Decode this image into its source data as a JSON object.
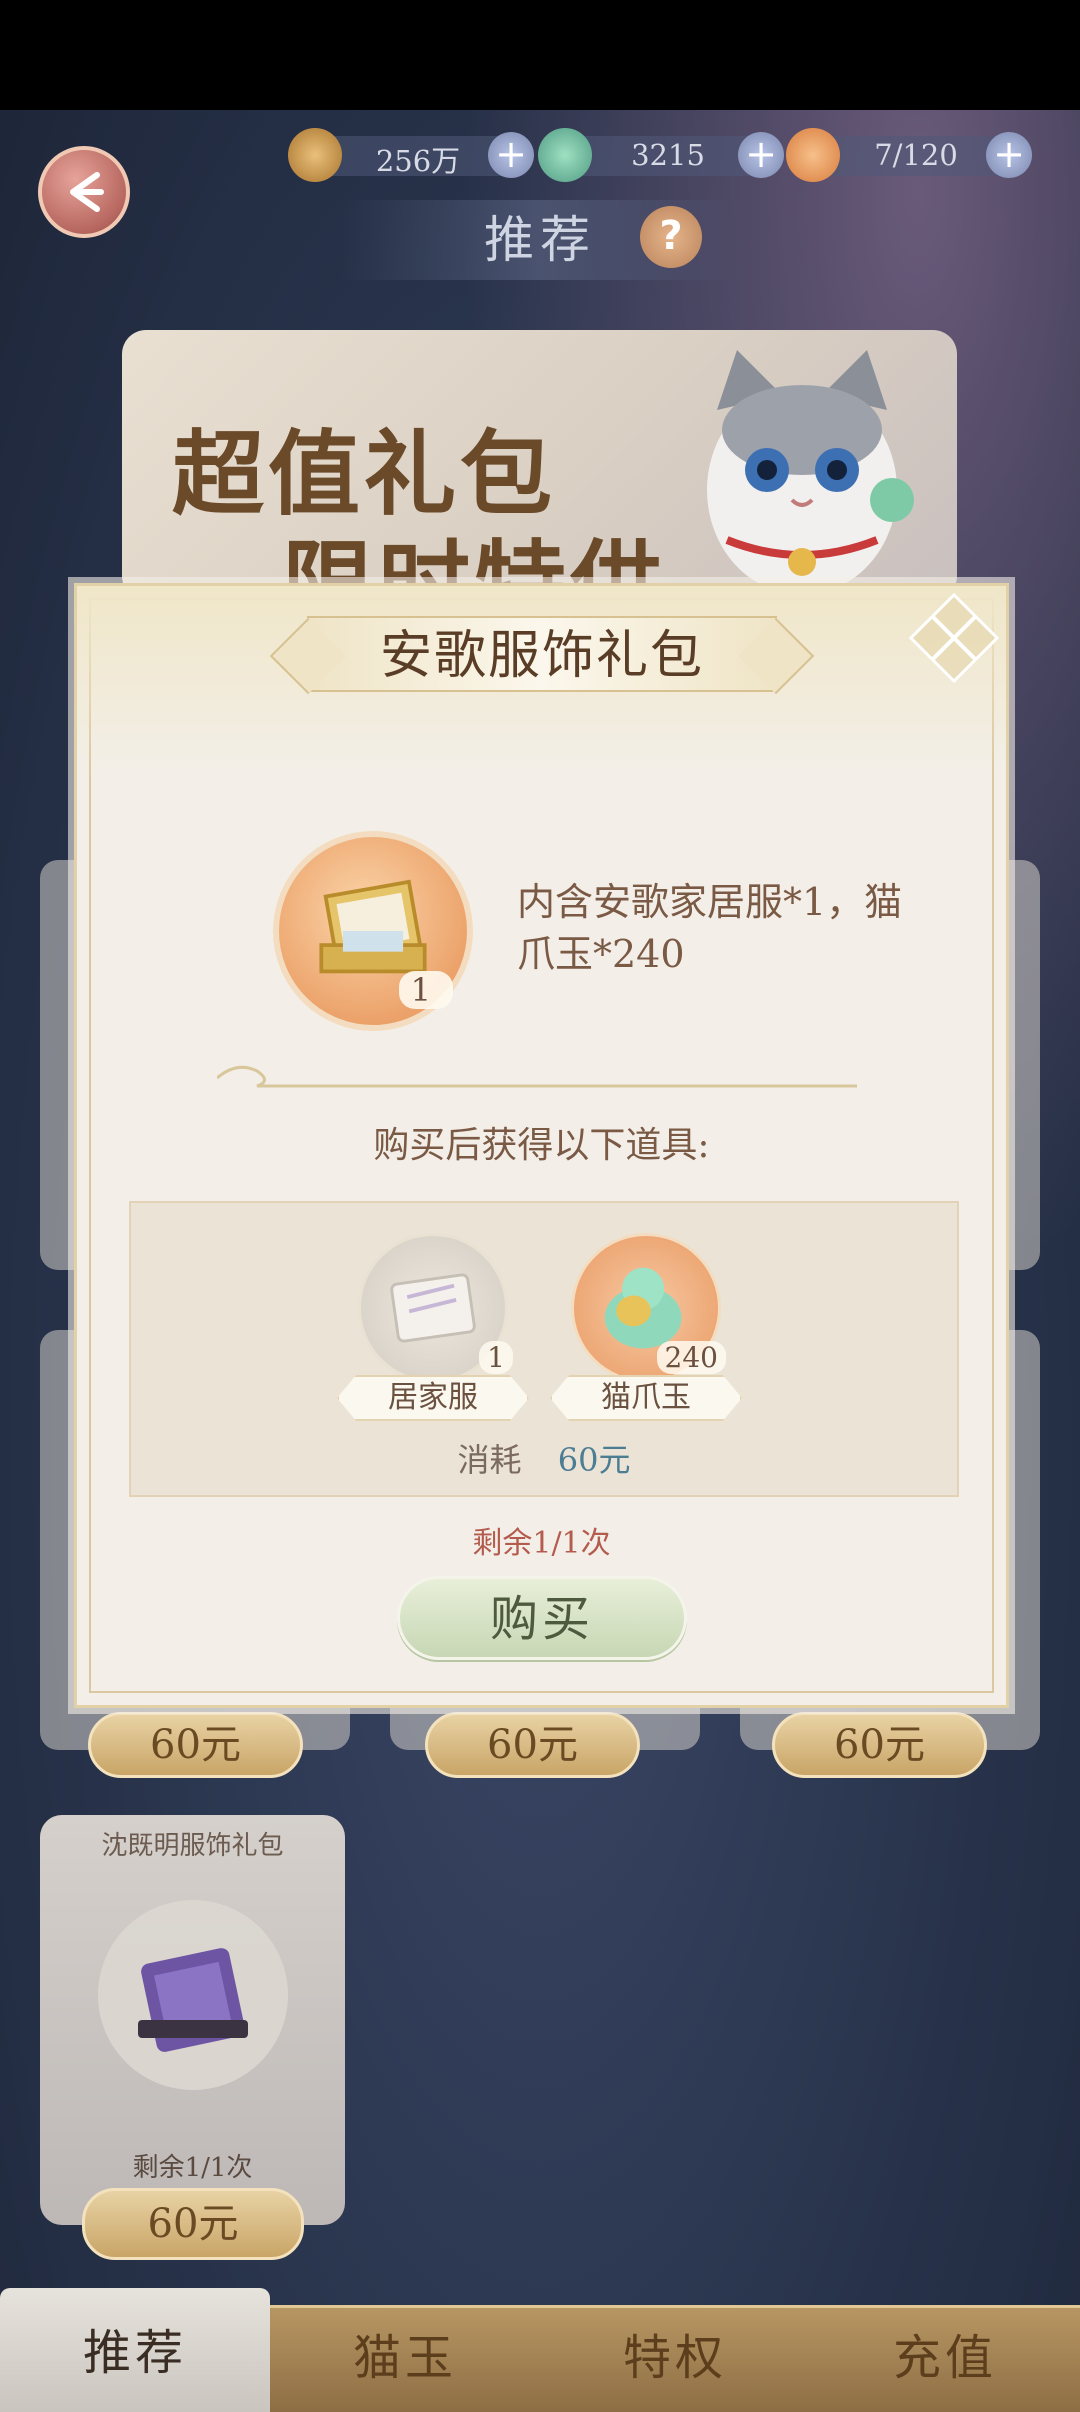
{
  "resources": {
    "coins": "256万",
    "jade": "3215",
    "stamina": "7/120"
  },
  "top": {
    "title": "推荐",
    "help": "?"
  },
  "banner": {
    "line1": "超值礼包",
    "line2": "限时特供"
  },
  "modal": {
    "title": "安歌服饰礼包",
    "pack_count": "1",
    "description": "内含安歌家居服*1，猫爪玉*240",
    "get_label": "购买后获得以下道具:",
    "items": [
      {
        "name": "居家服",
        "qty": "1",
        "icon": "clothing-icon"
      },
      {
        "name": "猫爪玉",
        "qty": "240",
        "icon": "cat-jade-icon"
      }
    ],
    "cost_label": "消耗",
    "cost_value": "60元",
    "remaining": "剩余1/1次",
    "buy": "购买"
  },
  "background_cards": {
    "prices": [
      "60元",
      "60元",
      "60元"
    ],
    "small_card": {
      "label": "沈既明服饰礼包",
      "remaining": "剩余1/1次",
      "price": "60元"
    }
  },
  "tabs": [
    {
      "label": "推荐",
      "active": true
    },
    {
      "label": "猫玉",
      "active": false
    },
    {
      "label": "特权",
      "active": false
    },
    {
      "label": "充值",
      "active": false
    }
  ],
  "colors": {
    "accent_gold": "#c9a567",
    "modal_bg": "#f3efe8",
    "remaining_red": "#b45b4e",
    "price_blue": "#4d7d93"
  }
}
